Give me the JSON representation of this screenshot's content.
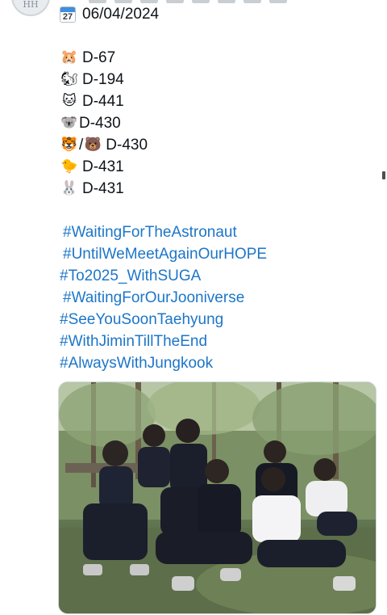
{
  "tweet": {
    "date_icon": "calendar-icon",
    "calendar_month": "Mar",
    "calendar_day": "27",
    "date": "06/04/2024",
    "countdowns": [
      {
        "icons": [
          "hamster-face"
        ],
        "text": "D-67"
      },
      {
        "icons": [
          "squirrel"
        ],
        "text": "D-194"
      },
      {
        "icons": [
          "cat-face"
        ],
        "text": "D-441"
      },
      {
        "icons": [
          "koala"
        ],
        "text": "D-430"
      },
      {
        "icons": [
          "tiger-face",
          "bear-face"
        ],
        "separator": "/",
        "text": "D-430"
      },
      {
        "icons": [
          "baby-chick"
        ],
        "text": "D-431"
      },
      {
        "icons": [
          "rabbit-face"
        ],
        "text": "D-431"
      }
    ],
    "hashtags": [
      "#WaitingForTheAstronaut",
      "#UntilWeMeetAgainOurHOPE",
      "#To2025_WithSUGA",
      "#WaitingForOurJooniverse",
      "#SeeYouSoonTaehyung",
      "#WithJiminTillTheEnd",
      "#AlwaysWithJungkook"
    ],
    "link_color": "#1d76c8",
    "media": {
      "type": "photo",
      "description_icon": "group-photo"
    }
  }
}
